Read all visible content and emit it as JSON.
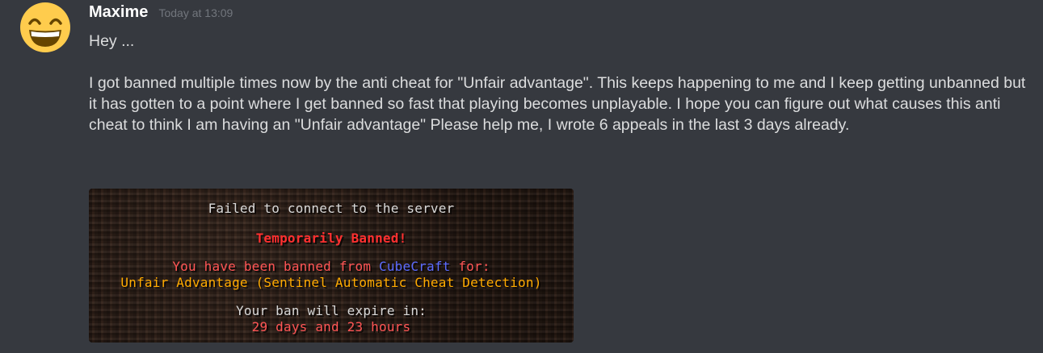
{
  "message": {
    "username": "Maxime",
    "timestamp": "Today at 13:09",
    "avatar_icon": "grinning-face-emoji-icon",
    "text": "Hey ...\n\nI got banned multiple times now by the anti cheat for \"Unfair advantage\". This keeps happening to me and I keep getting unbanned but it has gotten to a point where I get banned so fast that playing becomes unplayable. I hope you can figure out what causes this anti cheat to think I am having an \"Unfair advantage\" Please help me, I wrote 6 appeals in the last 3 days already."
  },
  "attachment": {
    "line1": "Failed to connect to the server",
    "line2": "Temporarily Banned!",
    "line3_prefix": "You have been banned from ",
    "line3_server": "CubeCraft",
    "line3_suffix": " for:",
    "line4": "Unfair Advantage (Sentinel Automatic Cheat Detection)",
    "line5": "Your ban will expire in:",
    "line6": "29 days and 23 hours"
  },
  "colors": {
    "background": "#36393f",
    "username": "#ffffff",
    "timestamp": "#72767d",
    "text": "#dcddde",
    "mc_red": "#ff3030",
    "mc_blue": "#5b6bff",
    "mc_gold": "#ffaa00"
  }
}
